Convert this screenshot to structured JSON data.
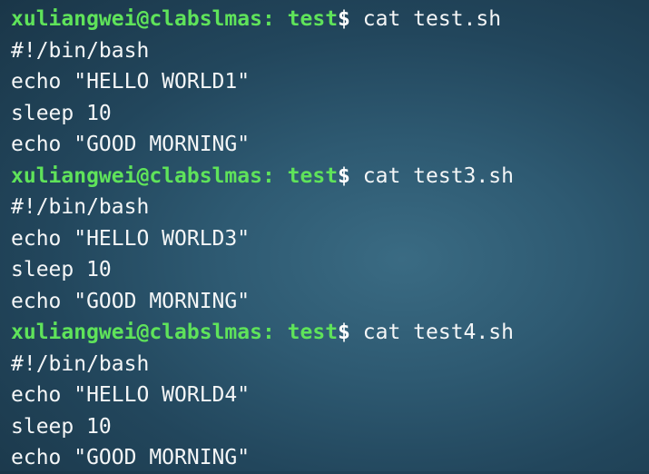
{
  "terminal": {
    "prompt_user_host": "xuliangwei@clabslmas:",
    "prompt_dir": "test",
    "prompt_symbol": "$",
    "blocks": [
      {
        "command": "cat test.sh",
        "output": [
          "#!/bin/bash",
          "echo \"HELLO WORLD1\"",
          "sleep 10",
          "echo \"GOOD MORNING\""
        ]
      },
      {
        "command": "cat test3.sh",
        "output": [
          "#!/bin/bash",
          "echo \"HELLO WORLD3\"",
          "sleep 10",
          "echo \"GOOD MORNING\""
        ]
      },
      {
        "command": "cat test4.sh",
        "output": [
          "#!/bin/bash",
          "echo \"HELLO WORLD4\"",
          "sleep 10",
          "echo \"GOOD MORNING\""
        ]
      }
    ]
  }
}
